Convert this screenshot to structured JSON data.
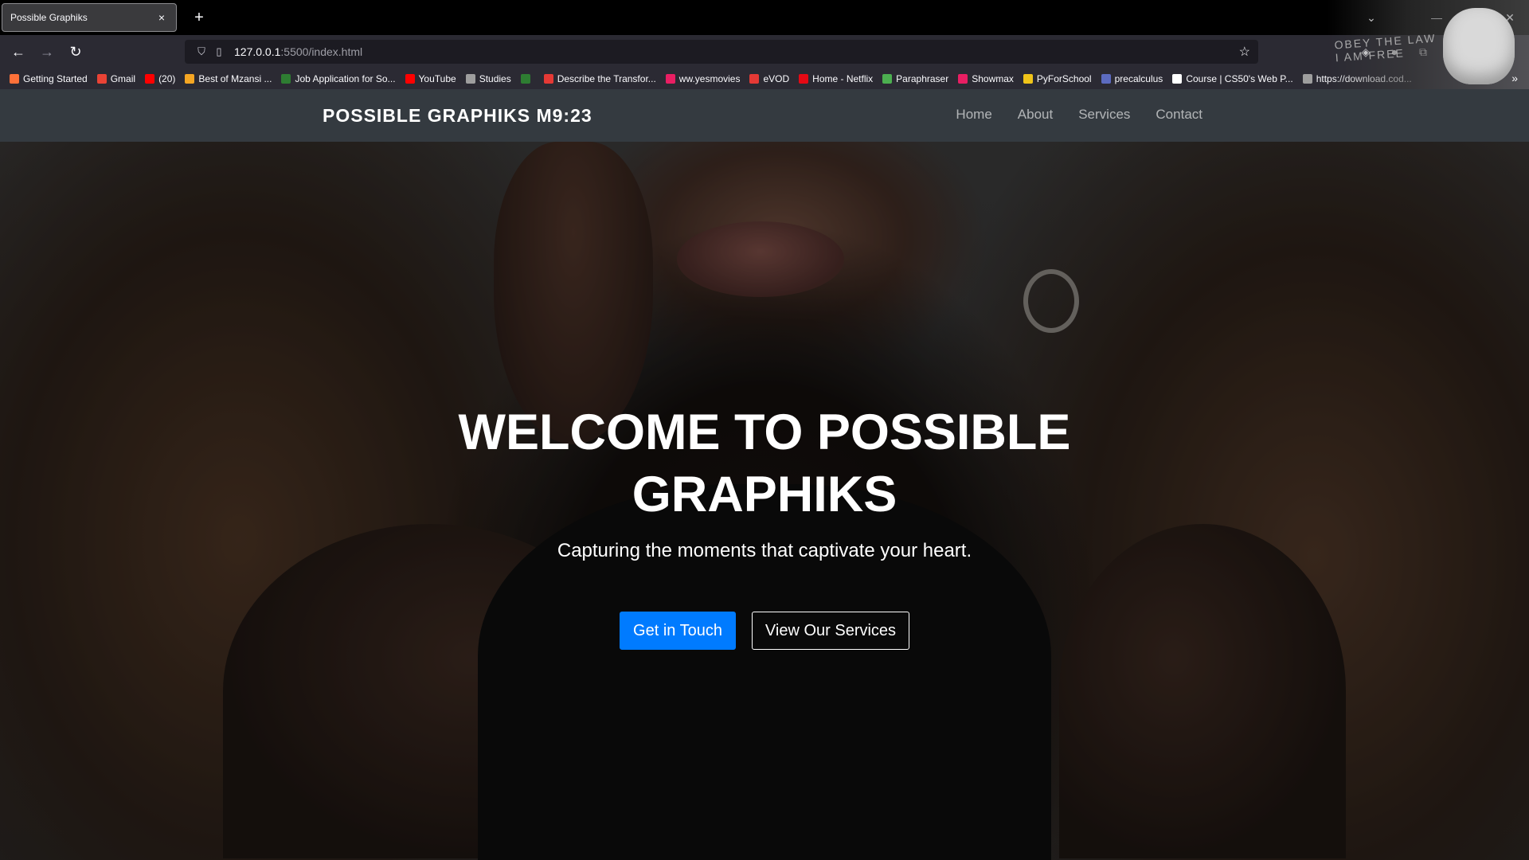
{
  "browser": {
    "tab_title": "Possible Graphiks",
    "tab_close": "×",
    "new_tab": "+",
    "url_host": "127.0.0.1",
    "url_path": ":5500/index.html",
    "bookmarks": [
      {
        "label": "Getting Started",
        "color": "#ff7139"
      },
      {
        "label": "Gmail",
        "color": "#ea4335"
      },
      {
        "label": "(20)",
        "color": "#ff0000"
      },
      {
        "label": "Best of Mzansi ...",
        "color": "#f5a623"
      },
      {
        "label": "Job Application for So...",
        "color": "#2e7d32"
      },
      {
        "label": "YouTube",
        "color": "#ff0000"
      },
      {
        "label": "Studies",
        "color": "#9e9e9e"
      },
      {
        "label": "",
        "color": "#2e7d32"
      },
      {
        "label": "Describe the Transfor...",
        "color": "#e53935"
      },
      {
        "label": "ww.yesmovies",
        "color": "#e91e63"
      },
      {
        "label": "eVOD",
        "color": "#e53935"
      },
      {
        "label": "Home - Netflix",
        "color": "#e50914"
      },
      {
        "label": "Paraphraser",
        "color": "#4caf50"
      },
      {
        "label": "Showmax",
        "color": "#e91e63"
      },
      {
        "label": "PyForSchool",
        "color": "#f0c419"
      },
      {
        "label": "precalculus",
        "color": "#5c6bc0"
      },
      {
        "label": "Course | CS50's Web P...",
        "color": "#ffffff"
      },
      {
        "label": "https://download.cod...",
        "color": "#9e9e9e"
      }
    ],
    "theme_text": "OBEY THE LAW\nI AM FREE"
  },
  "site": {
    "brand": "POSSIBLE GRAPHIKS M9:23",
    "nav": [
      "Home",
      "About",
      "Services",
      "Contact"
    ],
    "hero_title": "WELCOME TO POSSIBLE GRAPHIKS",
    "hero_subtitle": "Capturing the moments that captivate your heart.",
    "cta_primary": "Get in Touch",
    "cta_secondary": "View Our Services",
    "accent_color": "#007bff",
    "nav_bg": "#343a40"
  }
}
